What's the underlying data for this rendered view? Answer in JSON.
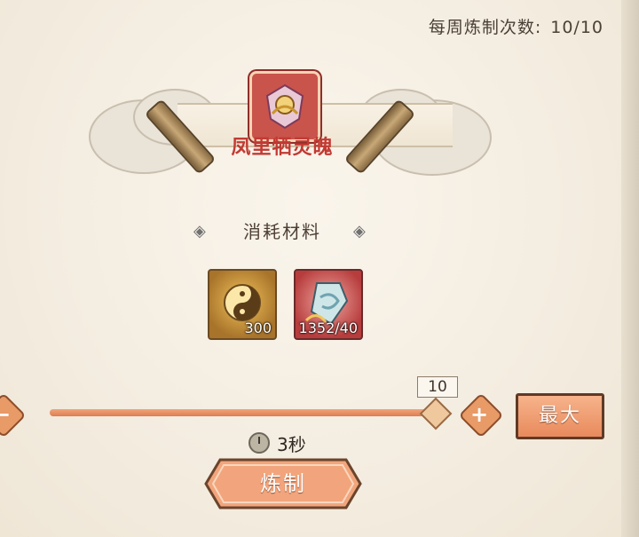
{
  "header": {
    "weekly_label": "每周炼制次数:",
    "weekly_value": "10/10"
  },
  "target_item": {
    "name": "凤里牺灵魄",
    "icon": "phoenix-spirit-icon"
  },
  "materials": {
    "title": "消耗材料",
    "items": [
      {
        "icon": "yin-yang-token-icon",
        "count": "300"
      },
      {
        "icon": "spirit-crystal-icon",
        "count": "1352/40"
      }
    ]
  },
  "quantity": {
    "value": "10",
    "fill_fraction": 1.0,
    "max_label": "最大",
    "minus_glyph": "−",
    "plus_glyph": "+"
  },
  "time": {
    "value": "3秒",
    "icon": "clock-icon"
  },
  "action": {
    "refine_label": "炼制"
  },
  "colors": {
    "accent": "#e88a5d",
    "item_name": "#c23a33",
    "background": "#f3ecdf"
  }
}
